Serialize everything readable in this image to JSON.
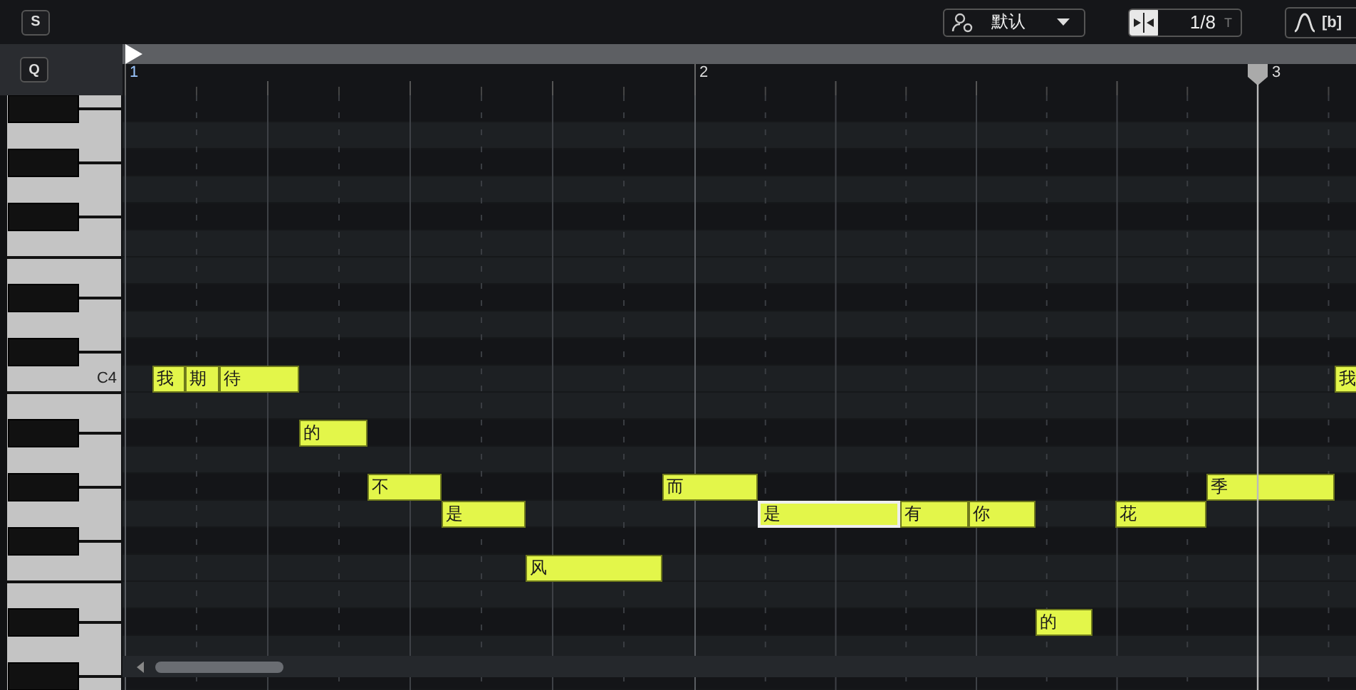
{
  "toolbar": {
    "solo_button": "S",
    "preset_dropdown": {
      "value": "默认"
    },
    "snap": {
      "value": "1/8",
      "type_label": "T"
    },
    "bracket_button": "[b]"
  },
  "quantize_button": "Q",
  "ruler": {
    "bars": [
      "1",
      "2",
      "3"
    ]
  },
  "keyboard": {
    "octave_label": "C4"
  },
  "notes": [
    {
      "lyric": "我",
      "selected": false
    },
    {
      "lyric": "期",
      "selected": false
    },
    {
      "lyric": "待",
      "selected": false
    },
    {
      "lyric": "的",
      "selected": false
    },
    {
      "lyric": "不",
      "selected": false
    },
    {
      "lyric": "是",
      "selected": false
    },
    {
      "lyric": "风",
      "selected": false
    },
    {
      "lyric": "而",
      "selected": false
    },
    {
      "lyric": "是",
      "selected": true
    },
    {
      "lyric": "有",
      "selected": false
    },
    {
      "lyric": "你",
      "selected": false
    },
    {
      "lyric": "的",
      "selected": false
    },
    {
      "lyric": "花",
      "selected": false
    },
    {
      "lyric": "季",
      "selected": false
    },
    {
      "lyric": "我",
      "selected": false
    }
  ]
}
